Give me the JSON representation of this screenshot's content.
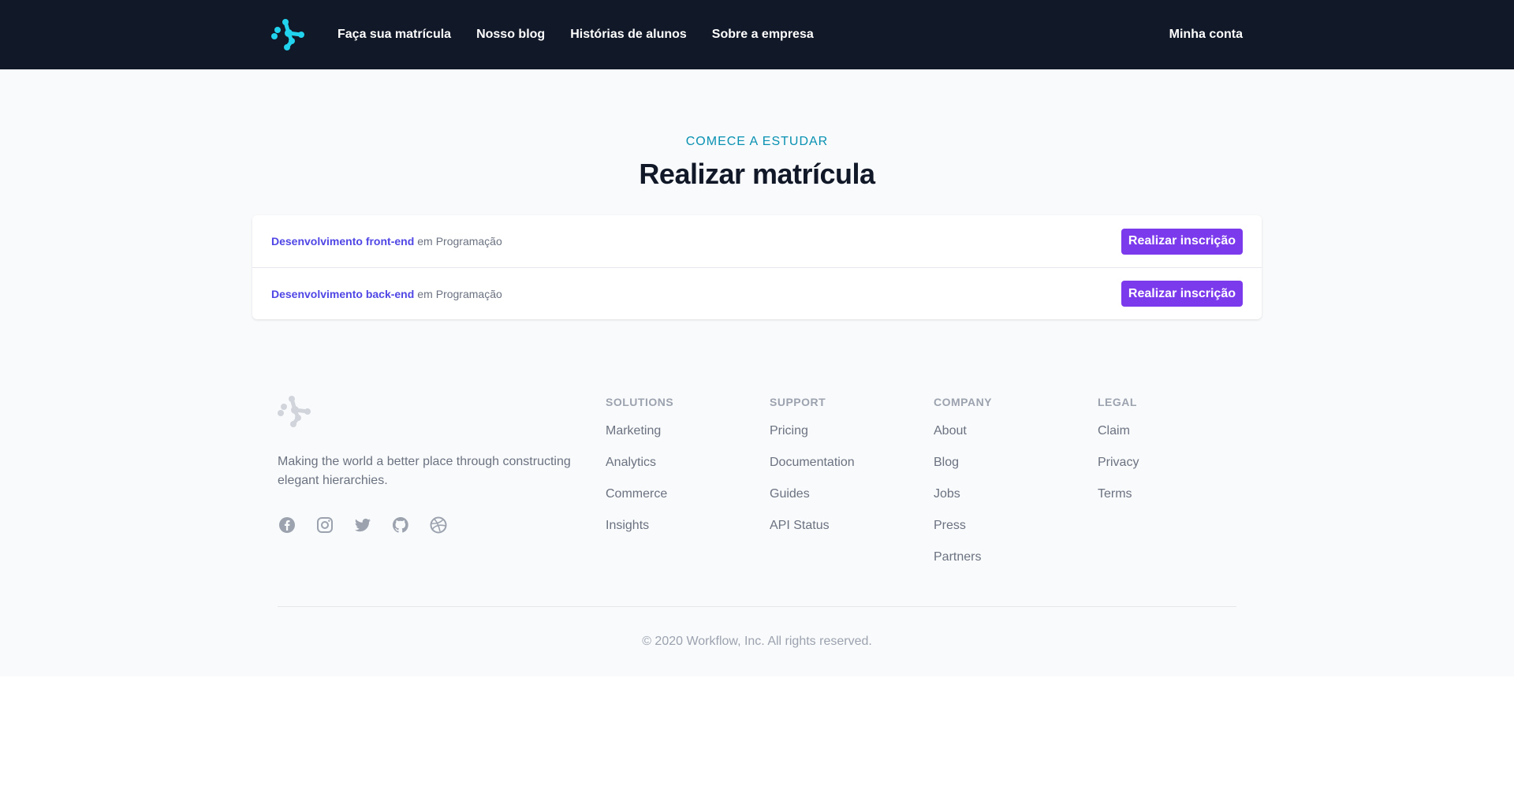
{
  "header": {
    "nav": [
      "Faça sua matrícula",
      "Nosso blog",
      "Histórias de alunos",
      "Sobre a empresa"
    ],
    "account": "Minha conta",
    "logo_color": "#22d3ee",
    "background": "#111827"
  },
  "hero": {
    "eyebrow": "COMECE A ESTUDAR",
    "title": "Realizar matrícula"
  },
  "courses": [
    {
      "name": "Desenvolvimento front-end",
      "connector": "em",
      "category": "Programação",
      "button": "Realizar inscrição"
    },
    {
      "name": "Desenvolvimento back-end",
      "connector": "em",
      "category": "Programação",
      "button": "Realizar inscrição"
    }
  ],
  "footer": {
    "description": "Making the world a better place through constructing elegant hierarchies.",
    "socials": [
      "facebook-icon",
      "instagram-icon",
      "twitter-icon",
      "github-icon",
      "dribbble-icon"
    ],
    "columns": [
      {
        "heading": "Solutions",
        "links": [
          "Marketing",
          "Analytics",
          "Commerce",
          "Insights"
        ]
      },
      {
        "heading": "Support",
        "links": [
          "Pricing",
          "Documentation",
          "Guides",
          "API Status"
        ]
      },
      {
        "heading": "Company",
        "links": [
          "About",
          "Blog",
          "Jobs",
          "Press",
          "Partners"
        ]
      },
      {
        "heading": "Legal",
        "links": [
          "Claim",
          "Privacy",
          "Terms"
        ]
      }
    ],
    "copyright": "© 2020 Workflow, Inc. All rights reserved."
  },
  "colors": {
    "accent_purple": "#7c3aed",
    "link_indigo": "#4f46e5",
    "eyebrow_cyan": "#0891b2"
  }
}
